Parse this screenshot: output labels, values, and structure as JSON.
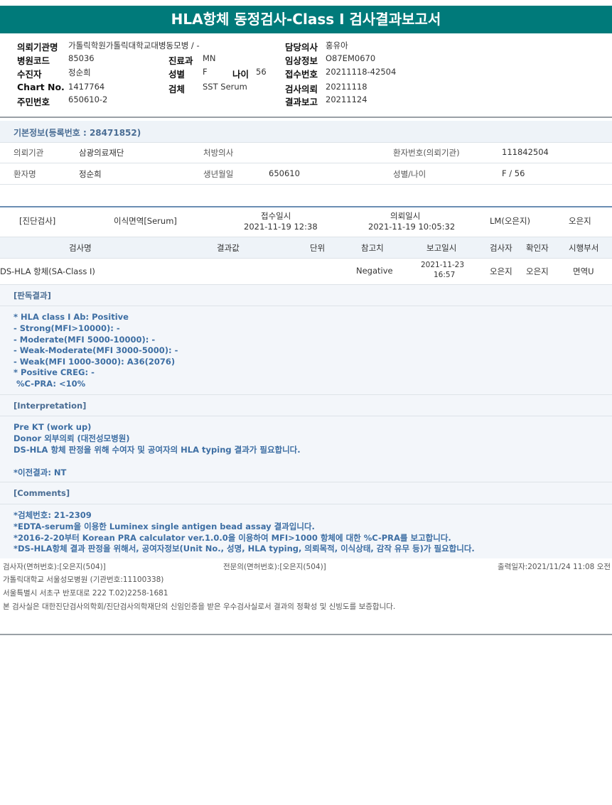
{
  "title": "HLA항체 동정검사-Class I 검사결과보고서",
  "header": {
    "req_org_label": "의뢰기관명",
    "req_org": "가톨릭학원가톨릭대학교대병동모병 / -",
    "doctor_label": "담당의사",
    "doctor": "홍유아",
    "hosp_code_label": "병원코드",
    "hosp_code": "85036",
    "dept_label": "진료과",
    "dept": "MN",
    "clinical_label": "임상정보",
    "clinical": "O87EM0670",
    "recipient_label": "수진자",
    "recipient": "정순희",
    "sex_label": "성별",
    "sex": "F",
    "age_label": "나이",
    "age": "56",
    "receipt_no_label": "접수번호",
    "receipt_no": "20211118-42504",
    "chart_label": "Chart No.",
    "chart": "1417764",
    "specimen_label": "검체",
    "specimen": "SST Serum",
    "test_req_label": "검사의뢰",
    "test_req": "20211118",
    "id_label": "주민번호",
    "id": "650610-2",
    "result_report_label": "결과보고",
    "result_report": "20211124"
  },
  "basic": {
    "title": "기본정보(등록번호 : 28471852)",
    "org_label": "의뢰기관",
    "org": "삼광의료재단",
    "doctor_label": "처방의사",
    "doctor": "",
    "patient_no_label": "환자번호(의뢰기관)",
    "patient_no": "111842504",
    "patient_label": "환자명",
    "patient": "정순희",
    "dob_label": "생년월일",
    "dob": "650610",
    "sex_age_label": "성별/나이",
    "sex_age": "F / 56"
  },
  "exam": {
    "diag_label": "[진단검사]",
    "specimen": "이식면역[Serum]",
    "receipt_label": "접수일시",
    "receipt": "2021-11-19 12:38",
    "request_label": "의뢰일시",
    "request": "2021-11-19 10:05:32",
    "lm": "LM(오은지)",
    "person": "오은지"
  },
  "table": {
    "headers": [
      "검사명",
      "결과값",
      "단위",
      "참고치",
      "보고일시",
      "검사자",
      "확인자",
      "시행부서"
    ],
    "row": {
      "name": "DS-HLA 항체(SA-Class I)",
      "result": "",
      "unit": "",
      "reference": "Negative",
      "report_date": "2021-11-23",
      "report_time": "16:57",
      "tester": "오은지",
      "confirmer": "오은지",
      "dept": "면역U"
    }
  },
  "judgement": {
    "title": "[판독결과]",
    "lines": [
      "* HLA class I Ab: Positive",
      "- Strong(MFI>10000): -",
      "- Moderate(MFI 5000-10000): -",
      "- Weak-Moderate(MFI 3000-5000): -",
      "- Weak(MFI 1000-3000): A36(2076)",
      "* Positive CREG: -",
      " %C-PRA: <10%"
    ]
  },
  "interpretation": {
    "title": "[Interpretation]",
    "lines": [
      "Pre KT (work up)",
      "Donor 외부의뢰 (대전성모병원)",
      "DS-HLA 항체 판정을 위해 수여자 및 공여자의 HLA typing 결과가 필요합니다.",
      "",
      "*이전결과: NT"
    ]
  },
  "comments": {
    "title": "[Comments]",
    "lines": [
      "*검체번호: 21-2309",
      "*EDTA-serum을 이용한 Luminex single antigen bead assay 결과입니다.",
      "*2016-2-20부터 Korean PRA calculator ver.1.0.0을 이용하여 MFI>1000 항체에 대한 %C-PRA를 보고합니다.",
      "*DS-HLA항체 결과 판정을 위해서, 공여자정보(Unit No., 성명, HLA typing, 의뢰목적, 이식상태, 감작 유무 등)가 필요합니다."
    ]
  },
  "footer": {
    "tester": "검사자(면허번호):[오은지(504)]",
    "specialist": "전문의(면허번호):[오은지(504)]",
    "printed": "출력일자:2021/11/24 11:08 오전",
    "hospital": "가톨릭대학교 서울성모병원 (기관번호:11100338)",
    "address": "서울특별시 서초구 반포대로 222 T.02)2258-1681",
    "cert": "본 검사실은 대한진단검사의학회/진단검사의학재단의 신임인증을 받은 우수검사실로서 결과의 정확성 및 신빙도를 보증합니다."
  }
}
